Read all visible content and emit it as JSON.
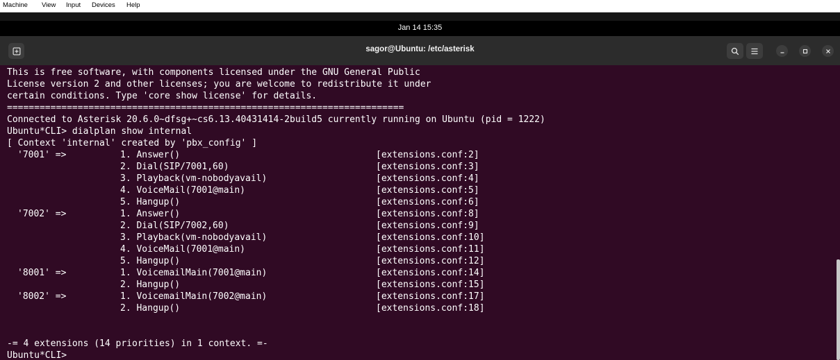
{
  "menu": {
    "items": [
      "Machine",
      "View",
      "Input",
      "Devices",
      "Help"
    ]
  },
  "topbar": {
    "clock": "Jan 14  15:35"
  },
  "window": {
    "title": "sagor@Ubuntu: /etc/asterisk"
  },
  "icons": {
    "new_tab": "new-tab-icon",
    "search": "search-icon",
    "menu": "hamburger-menu-icon",
    "minimize": "minimize-icon",
    "maximize": "maximize-icon",
    "close": "close-icon"
  },
  "colors": {
    "terminal_bg": "#300a24",
    "titlebar_bg": "#2c2c2c",
    "text": "#ffffff"
  },
  "terminal": {
    "preamble": [
      "This is free software, with components licensed under the GNU General Public",
      "License version 2 and other licenses; you are welcome to redistribute it under",
      "certain conditions. Type 'core show license' for details.",
      "=========================================================================",
      "Connected to Asterisk 20.6.0~dfsg+~cs6.13.40431414-2build5 currently running on Ubuntu (pid = 1222)",
      "Ubuntu*CLI> dialplan show internal",
      "[ Context 'internal' created by 'pbx_config' ]"
    ],
    "rows": [
      {
        "ext": "'7001' =>",
        "app": "1. Answer()",
        "src": "[extensions.conf:2]"
      },
      {
        "ext": "",
        "app": "2. Dial(SIP/7001,60)",
        "src": "[extensions.conf:3]"
      },
      {
        "ext": "",
        "app": "3. Playback(vm-nobodyavail)",
        "src": "[extensions.conf:4]"
      },
      {
        "ext": "",
        "app": "4. VoiceMail(7001@main)",
        "src": "[extensions.conf:5]"
      },
      {
        "ext": "",
        "app": "5. Hangup()",
        "src": "[extensions.conf:6]"
      },
      {
        "ext": "'7002' =>",
        "app": "1. Answer()",
        "src": "[extensions.conf:8]"
      },
      {
        "ext": "",
        "app": "2. Dial(SIP/7002,60)",
        "src": "[extensions.conf:9]"
      },
      {
        "ext": "",
        "app": "3. Playback(vm-nobodyavail)",
        "src": "[extensions.conf:10]"
      },
      {
        "ext": "",
        "app": "4. VoiceMail(7001@main)",
        "src": "[extensions.conf:11]"
      },
      {
        "ext": "",
        "app": "5. Hangup()",
        "src": "[extensions.conf:12]"
      },
      {
        "ext": "'8001' =>",
        "app": "1. VoicemailMain(7001@main)",
        "src": "[extensions.conf:14]"
      },
      {
        "ext": "",
        "app": "2. Hangup()",
        "src": "[extensions.conf:15]"
      },
      {
        "ext": "'8002' =>",
        "app": "1. VoicemailMain(7002@main)",
        "src": "[extensions.conf:17]"
      },
      {
        "ext": "",
        "app": "2. Hangup()",
        "src": "[extensions.conf:18]"
      }
    ],
    "summary": "-= 4 extensions (14 priorities) in 1 context. =-",
    "prompt": "Ubuntu*CLI>"
  }
}
